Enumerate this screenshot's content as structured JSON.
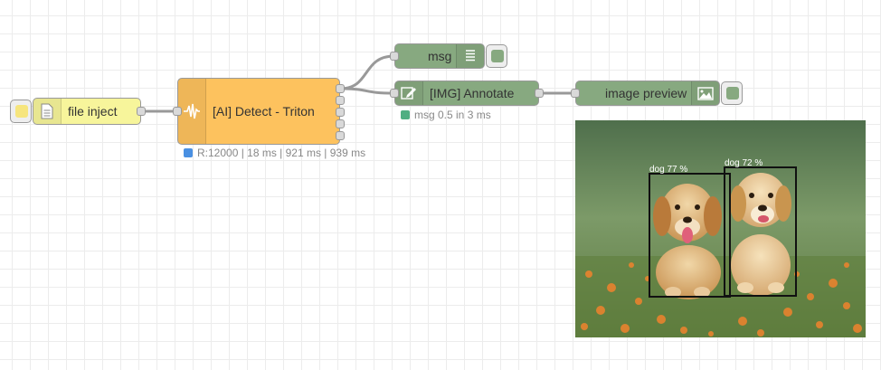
{
  "colors": {
    "inject": "#f7f59b",
    "ai_node": "#fdc25e",
    "green_node": "#87a980",
    "status_blue": "#4a90e2",
    "status_green": "#4fae82",
    "inject_button": "#f6e57d",
    "debug_button": "#87a980",
    "preview_button": "#87a980"
  },
  "nodes": {
    "file_inject": {
      "label": "file inject",
      "icon": "file-icon"
    },
    "detect": {
      "label": "[AI] Detect - Triton",
      "icon": "waveform-icon",
      "status": "R:12000 | 18 ms | 921 ms | 939 ms"
    },
    "msg": {
      "label": "msg",
      "icon": "list-icon"
    },
    "annotate": {
      "label": "[IMG] Annotate",
      "icon": "pencil-icon",
      "status": "msg 0.5 in 3 ms"
    },
    "image_preview": {
      "label": "image preview",
      "icon": "image-icon"
    }
  },
  "preview": {
    "detections": [
      {
        "label": "dog 77 %"
      },
      {
        "label": "dog 72 %"
      }
    ]
  }
}
